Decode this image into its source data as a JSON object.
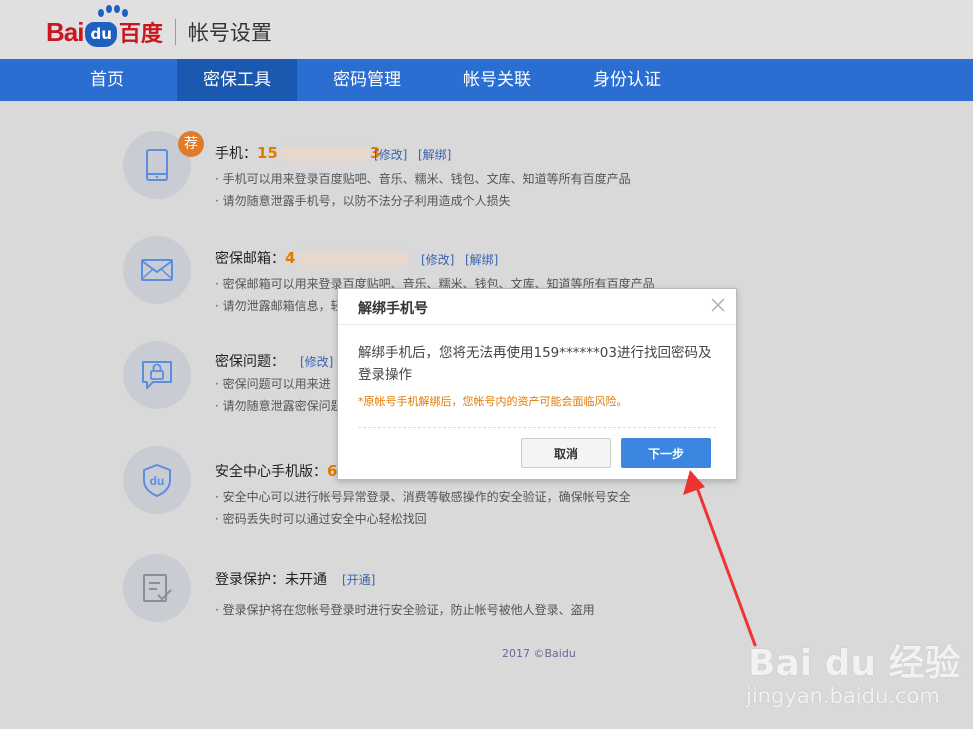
{
  "header": {
    "logo_bai": "Bai",
    "logo_du": "du",
    "logo_cn": "百度",
    "page_title": "帐号设置"
  },
  "nav": {
    "tabs": [
      "首页",
      "密保工具",
      "密码管理",
      "帐号关联",
      "身份认证"
    ],
    "active_index": 1
  },
  "rows": {
    "phone": {
      "icon": "phone-icon",
      "badge": "荐",
      "title": "手机：",
      "value_visible_start": "15",
      "value_visible_end": "3",
      "edit": "[修改]",
      "unbind": "[解绑]",
      "desc1": "· 手机可以用来登录百度贴吧、音乐、糯米、钱包、文库、知道等所有百度产品",
      "desc2": "· 请勿随意泄露手机号，以防不法分子利用造成个人损失"
    },
    "email": {
      "icon": "mail-icon",
      "title": "密保邮箱：",
      "value_visible_start": "4",
      "edit": "[修改]",
      "unbind": "[解绑]",
      "desc1": "· 密保邮箱可以用来登录百度贴吧、音乐、糯米、钱包、文库、知道等所有百度产品",
      "desc2": "· 请勿泄露邮箱信息，轻"
    },
    "question": {
      "icon": "lock-chat-icon",
      "title": "密保问题：",
      "edit": "[修改]",
      "desc1": "· 密保问题可以用来进",
      "desc2": "· 请勿随意泄露密保问题"
    },
    "secure_phone": {
      "icon": "shield-du-icon",
      "title": "安全中心手机版：",
      "value_visible_start": "6",
      "desc1": "· 安全中心可以进行帐号异常登录、消费等敏感操作的安全验证，确保帐号安全",
      "desc2": "· 密码丢失时可以通过安全中心轻松找回"
    },
    "login_protect": {
      "icon": "checklist-icon",
      "title": "登录保护：未开通",
      "open": "[开通]",
      "desc1": "· 登录保护将在您帐号登录时进行安全验证，防止帐号被他人登录、盗用"
    }
  },
  "footer": "2017 ©Baidu",
  "modal": {
    "title": "解绑手机号",
    "body": "解绑手机后，您将无法再使用159******03进行找回密码及登录操作",
    "warning": "*原帐号手机解绑后，您帐号内的资产可能会面临风险。",
    "cancel": "取消",
    "next": "下一步"
  },
  "watermark": {
    "logo": "Bai du 经验",
    "url": "jingyan.baidu.com"
  },
  "colors": {
    "nav_bg": "#2b6ed2",
    "nav_active": "#1b58b0",
    "accent_orange": "#e07b00",
    "link_blue": "#3b63b0",
    "arrow_red": "#ee3333"
  }
}
